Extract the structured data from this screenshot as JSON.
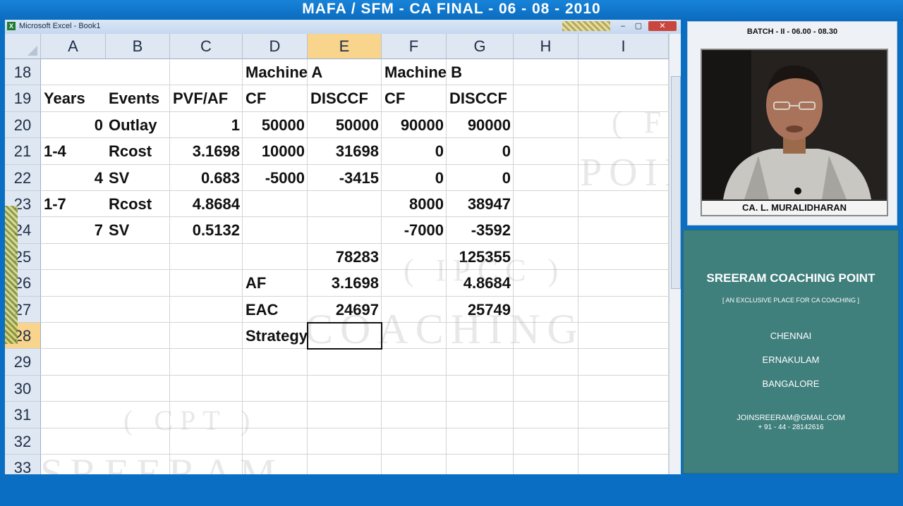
{
  "banner": {
    "title": "MAFA / SFM - CA FINAL - 06 - 08 - 2010"
  },
  "excel": {
    "window_title": "Microsoft Excel - Book1",
    "app_icon": "excel-icon",
    "window_buttons": {
      "minimize": "–",
      "maximize": "▢",
      "close": "✕"
    },
    "columns": [
      "A",
      "B",
      "C",
      "D",
      "E",
      "F",
      "G",
      "H",
      "I"
    ],
    "active_column": "E",
    "rows": [
      "18",
      "19",
      "20",
      "21",
      "22",
      "23",
      "24",
      "25",
      "26",
      "27",
      "28",
      "29",
      "30",
      "31",
      "32",
      "33"
    ],
    "active_row": "28",
    "cells": {
      "D18": "Machine A",
      "F18": "Machine B",
      "A19": "Years",
      "B19": "Events",
      "C19": "PVF/AF",
      "D19": "CF",
      "E19": "DISCCF",
      "F19": "CF",
      "G19": "DISCCF",
      "A20": "0",
      "B20": "Outlay",
      "C20": "1",
      "D20": "50000",
      "E20": "50000",
      "F20": "90000",
      "G20": "90000",
      "A21": "1-4",
      "B21": "Rcost",
      "C21": "3.1698",
      "D21": "10000",
      "E21": "31698",
      "F21": "0",
      "G21": "0",
      "A22": "4",
      "B22": "SV",
      "C22": "0.683",
      "D22": "-5000",
      "E22": "-3415",
      "F22": "0",
      "G22": "0",
      "A23": "1-7",
      "B23": "Rcost",
      "C23": "4.8684",
      "F23": "8000",
      "G23": "38947",
      "A24": "7",
      "B24": "SV",
      "C24": "0.5132",
      "F24": "-7000",
      "G24": "-3592",
      "E25": "78283",
      "G25": "125355",
      "D26": "AF",
      "E26": "3.1698",
      "G26": "4.8684",
      "D27": "EAC",
      "E27": "24697",
      "G27": "25749",
      "D28": "Strategy"
    },
    "selected_cell": "E28",
    "watermarks": [
      "( FINAL )",
      "POINT",
      "( IPCC )",
      "COACHING",
      "( CPT )",
      "SREERAM"
    ]
  },
  "panel": {
    "batch": "BATCH - II - 06.00 - 08.30",
    "presenter": "CA. L. MURALIDHARAN",
    "institute": "SREERAM COACHING POINT",
    "tagline": "[ AN EXCLUSIVE PLACE FOR CA COACHING ]",
    "cities": [
      "CHENNAI",
      "ERNAKULAM",
      "BANGALORE"
    ],
    "email": "JOINSREERAM@GMAIL.COM",
    "phone": "+ 91 - 44 - 28142616"
  }
}
